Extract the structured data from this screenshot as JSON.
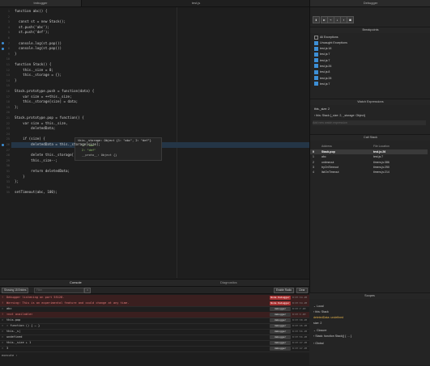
{
  "tabs": {
    "left": "tmbugger",
    "middle": "test.js",
    "right": "Debugger"
  },
  "editor": {
    "lines": [
      {
        "n": "1",
        "text": "function abc() {"
      },
      {
        "n": "2",
        "text": ""
      },
      {
        "n": "3",
        "text": "  const st = new Stack();"
      },
      {
        "n": "4",
        "text": "  st.push('abc');"
      },
      {
        "n": "5",
        "text": "  st.push('def');"
      },
      {
        "n": "6",
        "text": ""
      },
      {
        "n": "7",
        "text": "  console.log(st.pop())"
      },
      {
        "n": "8",
        "text": "  console.log(st.pop())"
      },
      {
        "n": "9",
        "text": "}"
      },
      {
        "n": "10",
        "text": ""
      },
      {
        "n": "11",
        "text": "function Stack() {"
      },
      {
        "n": "12",
        "text": "    this._size = 0;"
      },
      {
        "n": "13",
        "text": "    this._storage = {};"
      },
      {
        "n": "14",
        "text": "}"
      },
      {
        "n": "15",
        "text": ""
      },
      {
        "n": "16",
        "text": "Stack.prototype.push = function(data) {"
      },
      {
        "n": "17",
        "text": "    var size = ++this._size;"
      },
      {
        "n": "18",
        "text": "    this._storage[size] = data;"
      },
      {
        "n": "19",
        "text": "};"
      },
      {
        "n": "20",
        "text": ""
      },
      {
        "n": "21",
        "text": "Stack.prototype.pop = function() {"
      },
      {
        "n": "22",
        "text": "    var size = this._size,"
      },
      {
        "n": "23",
        "text": "        deletedData;"
      },
      {
        "n": "24",
        "text": ""
      },
      {
        "n": "25",
        "text": "    if (size) {"
      },
      {
        "n": "26",
        "text": "        deletedData = this._storage[size];"
      },
      {
        "n": "27",
        "text": ""
      },
      {
        "n": "28",
        "text": "        delete this._storage["
      },
      {
        "n": "29",
        "text": "        this._size--;"
      },
      {
        "n": "30",
        "text": ""
      },
      {
        "n": "31",
        "text": "        return deletedData;"
      },
      {
        "n": "32",
        "text": "    }"
      },
      {
        "n": "33",
        "text": "};"
      },
      {
        "n": "34",
        "text": ""
      },
      {
        "n": "35",
        "text": "setTimeout(abc, 100);"
      }
    ]
  },
  "tooltip": {
    "title": "this._storage: Object {1: \"abc\", 2: \"def\"}",
    "row1": "1: \"abc\"",
    "row2": "2: \"def\"",
    "row3": "__proto__: Object {}"
  },
  "breakpoints": {
    "header": "Breakpoints",
    "all": "All Exceptions",
    "uncaught": "Uncaught Exceptions",
    "items": [
      "test.js:18",
      "test.js:7",
      "test.js:7",
      "test.js:26",
      "test.js:8",
      "test.js:28",
      "test.js:7"
    ]
  },
  "watch": {
    "header": "Watch Expressions",
    "rows": [
      "this._size: 2",
      "this: Stack {_size: 2, _storage: Object}"
    ],
    "placeholder": "Add new watch expression"
  },
  "callstack": {
    "header": "Call Stack",
    "col_address": "Address",
    "col_file": "File Location",
    "rows": [
      {
        "i": "0",
        "addr": "Stack.pop",
        "file": "test.js:26"
      },
      {
        "i": "1",
        "addr": "abc",
        "file": "test.js:7"
      },
      {
        "i": "2",
        "addr": "ontimeout",
        "file": "timers.js:386"
      },
      {
        "i": "3",
        "addr": "tryOnTimeout",
        "file": "timers.js:250"
      },
      {
        "i": "4",
        "addr": "listOnTimeout",
        "file": "timers.js:214"
      }
    ]
  },
  "console": {
    "tab_console": "Console",
    "tab_diag": "Diagnostics",
    "filter_label": "Showing 15 Entries",
    "filter_placeholder": "Filter",
    "btn_clear": "Clear",
    "btn_enable": "Enable Radio",
    "rows": [
      {
        "type": "err",
        "msg": "Debugger listening on port 55128.",
        "tag": "Node Debugger",
        "time": "8:07:34 AM"
      },
      {
        "type": "err",
        "msg": "Warning: This is an experimental feature and could change at any time.",
        "tag": "Node Debugger",
        "time": "8:07:34 AM"
      },
      {
        "type": "log",
        "msg": "abc",
        "tag": "debugger",
        "time": "8:07:7 AM"
      },
      {
        "type": "err",
        "msg": "<not available>",
        "tag": "debugger",
        "time": "8:07:3 AM"
      },
      {
        "type": "log",
        "msg": "this.pop",
        "tag": "debugger",
        "time": "8:07:38 AM"
      },
      {
        "type": "log",
        "msg": "› function () { … }",
        "tag": "debugger",
        "time": "8:07:46 AM"
      },
      {
        "type": "log",
        "msg": "this._s|",
        "tag": "debugger",
        "time": "8:07:56 AM"
      },
      {
        "type": "log",
        "msg": "undefined",
        "tag": "debugger",
        "time": "8:07:56 AM"
      },
      {
        "type": "log",
        "msg": "this._size + 1",
        "tag": "debugger",
        "time": "8:07:47 AM"
      },
      {
        "type": "log",
        "msg": "3",
        "tag": "debugger",
        "time": "8:07:47 AM"
      }
    ],
    "prompt": "execute ›"
  },
  "scopes": {
    "header": "Scopes",
    "local": "Local",
    "this_row": "this: Stack",
    "deleted": "deletedData: undefined",
    "size": "size: 2",
    "closure": "Closure",
    "stack_fn": "Stack: function Stack() { … }",
    "global": "Global"
  }
}
